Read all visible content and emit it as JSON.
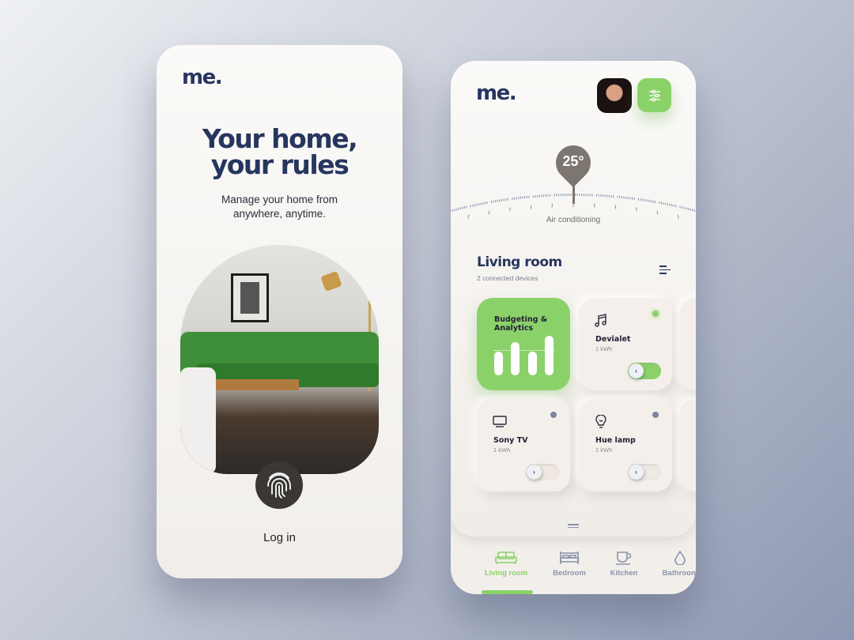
{
  "login_screen": {
    "logo": "me.",
    "headline_line1": "Your home,",
    "headline_line2": "your rules",
    "subtitle_line1": "Manage your home from",
    "subtitle_line2": "anywhere, anytime.",
    "login_label": "Log in"
  },
  "dashboard": {
    "logo": "me.",
    "temperature": "25°",
    "temperature_label": "Air conditioning",
    "room_title": "Living room",
    "room_subtitle": "2 connected devices",
    "analytics_card": {
      "title_line1": "Budgeting &",
      "title_line2": "Analytics"
    },
    "devices": [
      {
        "name": "Devialet",
        "usage": "1 kWh",
        "on": true,
        "icon": "music-note-icon"
      },
      {
        "name": "Sony TV",
        "usage": "1 kWh",
        "on": false,
        "icon": "tv-icon"
      },
      {
        "name": "Hue lamp",
        "usage": "1 kWh",
        "on": false,
        "icon": "lightbulb-icon"
      }
    ],
    "toggle_glyph": "›",
    "nav": [
      {
        "label": "Living room",
        "active": true
      },
      {
        "label": "Bedroom"
      },
      {
        "label": "Kitchen"
      },
      {
        "label": "Bathroom"
      }
    ]
  },
  "colors": {
    "accent": "#8bd16a",
    "navy": "#27365f"
  }
}
